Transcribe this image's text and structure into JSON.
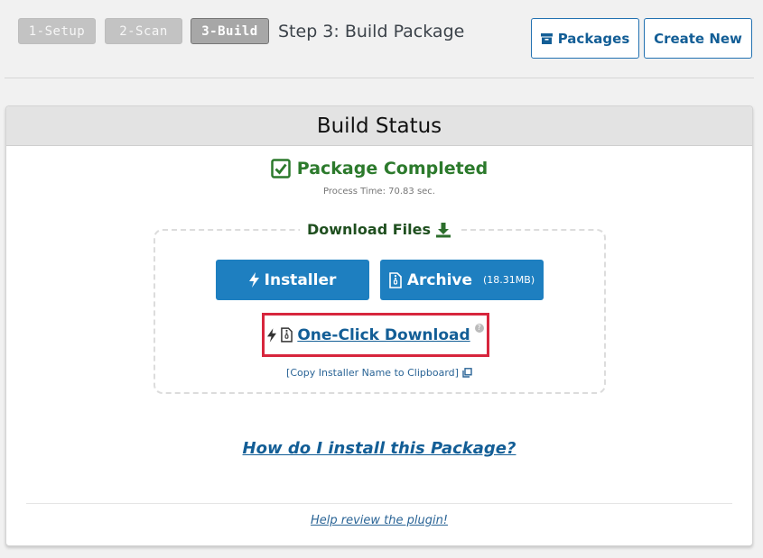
{
  "steps": [
    {
      "label": "1-Setup",
      "state": "inactive"
    },
    {
      "label": "2-Scan",
      "state": "inactive"
    },
    {
      "label": "3-Build",
      "state": "active"
    }
  ],
  "step_title": "Step 3: Build Package",
  "header_buttons": {
    "packages_label": "Packages",
    "packages_icon": "archive-icon",
    "create_new_label": "Create New"
  },
  "panel": {
    "title": "Build Status",
    "status": {
      "text": "Package Completed",
      "icon": "check-square-icon",
      "color": "#2c7a2c"
    },
    "process_time": "Process Time: 70.83 sec.",
    "download": {
      "legend": "Download Files",
      "legend_icon": "download-icon",
      "installer_label": "Installer",
      "installer_icon": "bolt-icon",
      "archive_label": "Archive",
      "archive_icon": "zip-file-icon",
      "archive_size": "(18.31MB)",
      "oneclick_label": "One-Click Download",
      "oneclick_help": "?",
      "copy_label": "[Copy Installer Name to Clipboard]",
      "copy_icon": "copy-icon"
    },
    "howto_link": "How do I install this Package?",
    "review_link": "Help review the plugin!"
  },
  "colors": {
    "accent": "#1e7fc0",
    "link": "#135e96",
    "highlight_border": "#d7263d"
  }
}
